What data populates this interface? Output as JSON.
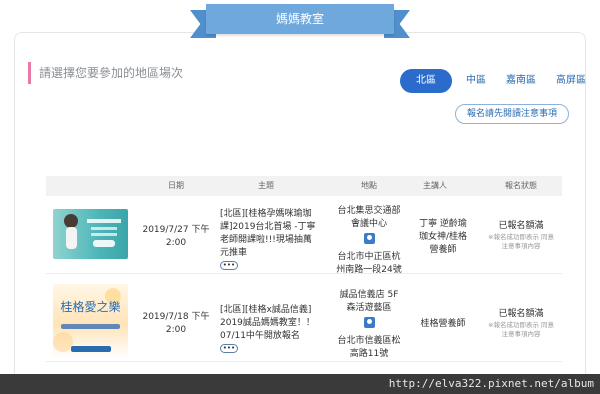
{
  "header": {
    "ribbon_title": "媽媽教室"
  },
  "filter": {
    "prompt": "請選擇您要參加的地區場次",
    "regions": [
      "北區",
      "中區",
      "嘉南區",
      "高屏區"
    ],
    "active_region": "北區",
    "notice_button": "報名請先閱讀注意事項"
  },
  "table": {
    "headers": [
      "日期",
      "主題",
      "地點",
      "主講人",
      "報名狀態"
    ],
    "rows": [
      {
        "date_line1": "2019/7/27 下午",
        "date_line2": "2:00",
        "topic": "[北區][桂格孕媽咪瑜珈課]2019台北首場 -丁寧老師開課啦!!!現場抽萬元推車",
        "venue": "台北集思交通部會議中心",
        "address": "台北市中正區杭州南路一段24號",
        "speaker": "丁寧 逆齡瑜珈女神/桂格營養師",
        "status": "已報名額滿",
        "status_note": "※報名成功即表示 同意注意事項內容",
        "more": "•••"
      },
      {
        "date_line1": "2019/7/18 下午",
        "date_line2": "2:00",
        "topic": "[北區][桂格x誠品信義] 2019誠品媽媽教室！！07/11中午開放報名",
        "venue": "誠品信義店 5F 森活遊藝區",
        "address": "台北市信義區松高路11號",
        "speaker": "桂格營養師",
        "status": "已報名額滿",
        "status_note": "※報名成功即表示 同意注意事項內容",
        "more": "•••",
        "thumb_title": "桂格愛之樂"
      }
    ]
  },
  "watermark": {
    "url": "http://elva322.pixnet.net/album"
  },
  "colors": {
    "ribbon": "#6fa8dc",
    "active_tab": "#2a6bcc",
    "accent_bar": "#e77aa6",
    "link": "#2a6bb0"
  }
}
